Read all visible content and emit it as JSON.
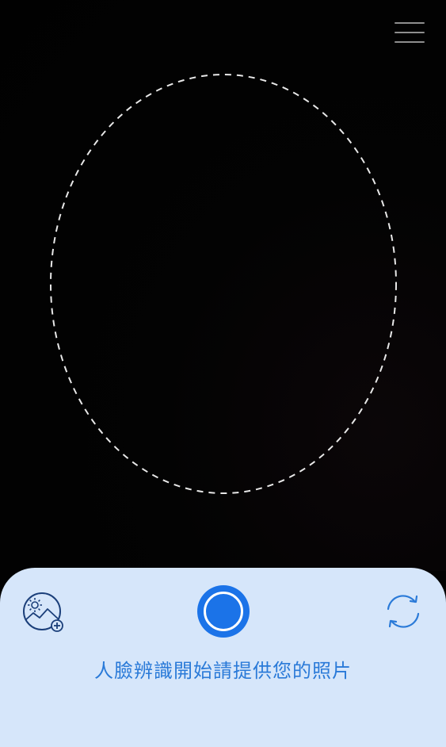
{
  "camera": {
    "menu_icon": "hamburger-menu-icon",
    "face_guide": "dashed-oval-outline"
  },
  "bottom_panel": {
    "gallery_icon": "image-add-icon",
    "shutter_icon": "shutter-circle-icon",
    "switch_camera_icon": "refresh-arrows-icon",
    "instruction": "人臉辨識開始請提供您的照片"
  },
  "colors": {
    "panel_background": "#d6e6fa",
    "accent_blue": "#1b73e8",
    "instruction_text": "#2a7ad8",
    "camera_background": "#020202"
  }
}
